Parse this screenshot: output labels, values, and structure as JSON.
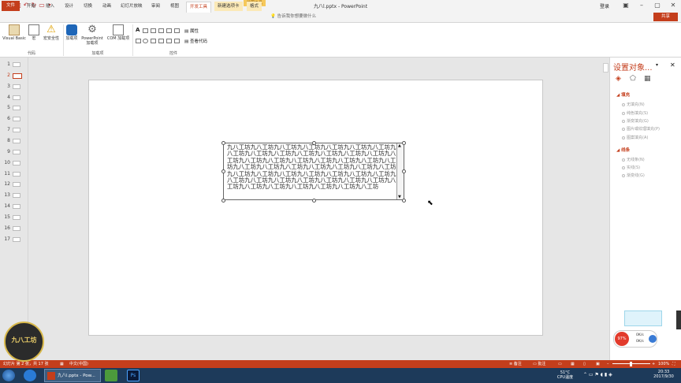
{
  "window": {
    "title": "九八l.pptx - PowerPoint",
    "context_tab_group": "绘图工具",
    "sign_in": "登录"
  },
  "tabs": {
    "file": "文件",
    "items": [
      "开始",
      "插入",
      "设计",
      "切换",
      "动画",
      "幻灯片放映",
      "审阅",
      "视图",
      "开发工具",
      "新建选项卡",
      "格式"
    ],
    "active": "开发工具",
    "tell_me": "告诉我你想要做什么",
    "share": "共享"
  },
  "ribbon": {
    "code_group": {
      "label": "代码",
      "visual_basic": "Visual Basic",
      "macro": "宏",
      "macro_security": "宏安全性"
    },
    "addins_group": {
      "label": "加载项",
      "addins": "加载项",
      "ppt_addins": "PowerPoint 加载项",
      "com_addins": "COM 加载项"
    },
    "controls_group": {
      "label": "控件",
      "properties": "属性",
      "view_code": "查看代码",
      "text_label": "A"
    }
  },
  "slides": {
    "numbers": [
      "1",
      "2",
      "3",
      "4",
      "5",
      "6",
      "7",
      "8",
      "9",
      "10",
      "11",
      "12",
      "13",
      "14",
      "15",
      "16",
      "17"
    ],
    "selected": "2"
  },
  "canvas": {
    "textbox_text": "九八工坊九八工坊九八工坊九八工坊九八工坊九八工坊九八工坊九八工坊九八工坊九八工坊九八工坊九八工坊九八工坊九八工坊九八工坊九八工坊九八工坊九八工坊九八工坊九八工坊九八工坊九八工坊九八工坊九八工坊九八工坊九八工坊九八工坊九八工坊九八工坊九八工坊九八工坊九八工坊九八工坊九八工坊九八工坊九八工坊九八工坊九八工坊九八工坊九八工坊九八工坊九八工坊九八工坊九八工坊九八工坊九八工坊九八工坊九八工坊九八工坊九八工坊"
  },
  "format_pane": {
    "title": "设置对象...",
    "fill_section": "填充",
    "fill_options": [
      "无填充(N)",
      "纯色填充(S)",
      "渐变填充(G)",
      "图片或纹理填充(P)",
      "图案填充(A)"
    ],
    "line_section": "线条",
    "line_options": [
      "无线条(N)",
      "实线(S)",
      "渐变线(G)"
    ]
  },
  "status_bar": {
    "slide_info": "幻灯片 第 2 张，共 17 张",
    "language": "中文(中国)",
    "notes": "备注",
    "comments": "批注",
    "zoom": "100%"
  },
  "taskbar": {
    "ppt_task": "九八l.pptx - Pow...",
    "cpu_temp": "51°C",
    "cpu_label": "CPU温度",
    "time": "20:33",
    "date": "2017/9/30"
  },
  "overlay": {
    "logo_text": "九八工坊",
    "speed_percent": "97%",
    "up_speed": "0K/s",
    "down_speed": "0K/s"
  },
  "colors": {
    "accent": "#c43e1c",
    "context_tab": "#f6c85a",
    "taskbar": "#1d3a5a"
  }
}
